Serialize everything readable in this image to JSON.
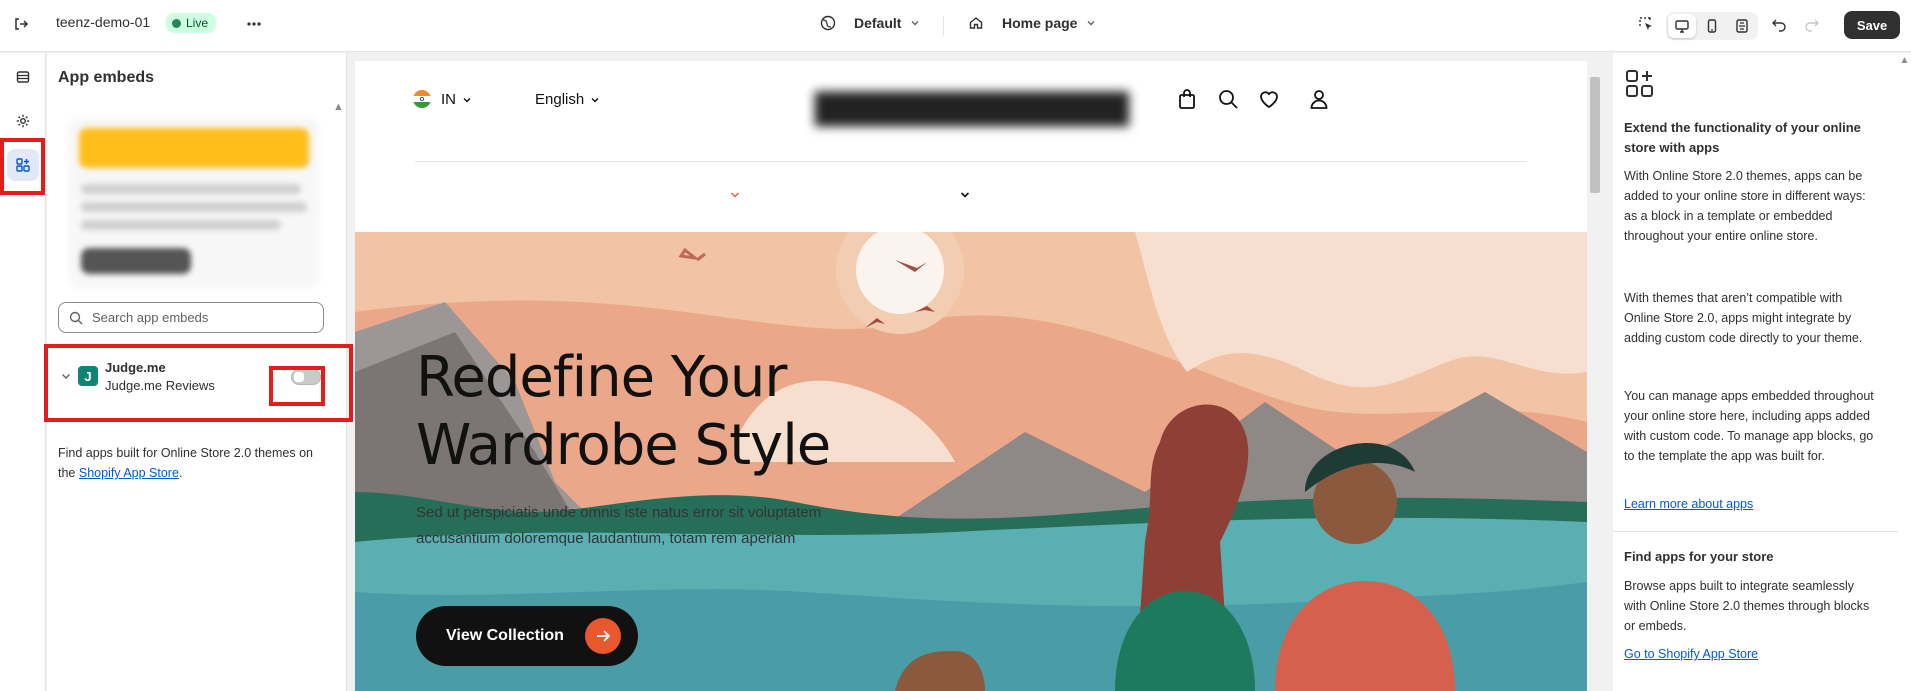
{
  "topbar": {
    "store_name": "teenz-demo-01",
    "status_badge": "Live",
    "theme_select": "Default",
    "page_select": "Home page",
    "save_label": "Save"
  },
  "panel": {
    "title": "App embeds",
    "search_placeholder": "Search app embeds",
    "embed": {
      "name": "Judge.me",
      "subtitle": "Judge.me Reviews",
      "logo_letter": "J",
      "enabled": false
    },
    "find_text": "Find apps built for Online Store 2.0 themes on the ",
    "find_link": "Shopify App Store",
    "find_suffix": "."
  },
  "preview": {
    "country": "IN",
    "language": "English",
    "hero_title_line1": "Redefine Your",
    "hero_title_line2": "Wardrobe Style",
    "hero_subtitle": "Sed ut perspiciatis unde omnis iste natus error sit voluptatem accusantium doloremque laudantium, totam rem aperiam",
    "hero_button": "View Collection"
  },
  "right_panel": {
    "heading1": "Extend the functionality of your online store with apps",
    "para1": "With Online Store 2.0 themes, apps can be added to your online store in different ways: as a block in a template or embedded throughout your entire online store.",
    "para2": "With themes that aren’t compatible with Online Store 2.0, apps might integrate by adding custom code directly to your theme.",
    "para3": "You can manage apps embedded throughout your online store here, including apps added with custom code. To manage app blocks, go to the template the app was built for.",
    "link1": "Learn more about apps",
    "heading2": "Find apps for your store",
    "para4": "Browse apps built to integrate seamlessly with Online Store 2.0 themes through blocks or embeds.",
    "link2": "Go to Shopify App Store"
  },
  "colors": {
    "accent_highlight": "#e51c1c",
    "live_badge_bg": "#cdfee1",
    "hero_button_arrow": "#e8572e",
    "link": "#005bd3"
  }
}
